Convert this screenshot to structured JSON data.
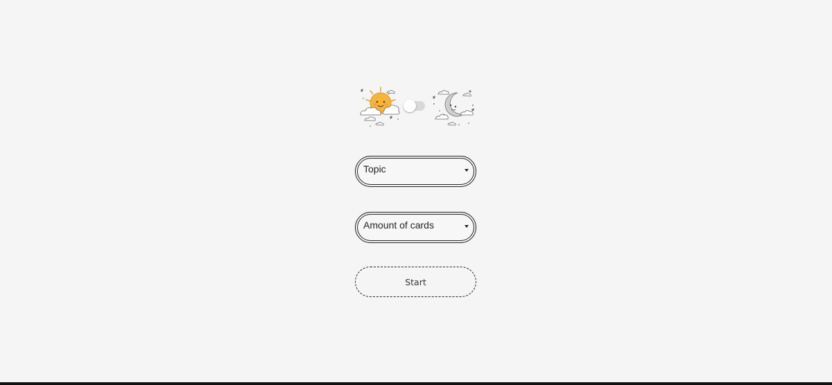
{
  "theme_toggle": {
    "light_icon": "sun-in-clouds-icon",
    "dark_icon": "moon-in-clouds-icon",
    "state": "light"
  },
  "topic_select": {
    "label": "Topic"
  },
  "amount_select": {
    "label": "Amount of cards"
  },
  "start_button": {
    "label": "Start"
  },
  "colors": {
    "background": "#f5f5f5",
    "border": "#222222",
    "sun": "#f5b43c",
    "moon": "#c8c8c8",
    "accent": "#8a6a8a"
  }
}
